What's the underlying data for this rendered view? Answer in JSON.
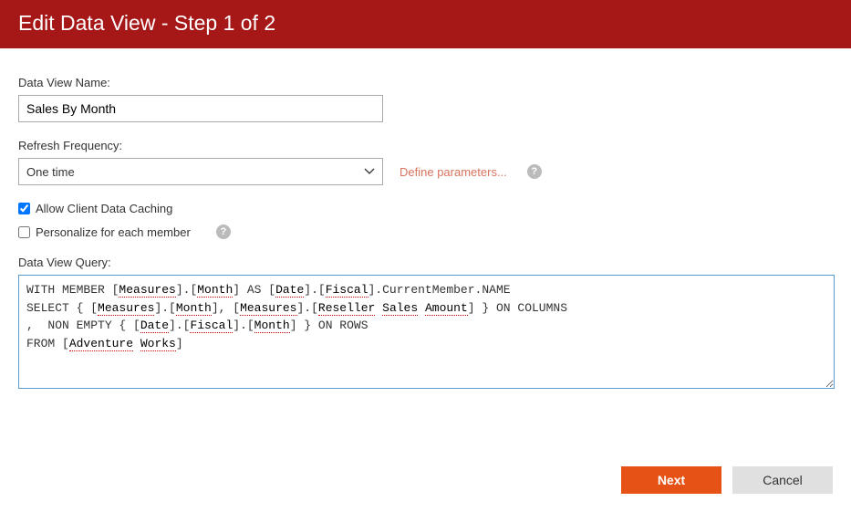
{
  "header": {
    "title": "Edit Data View - Step 1 of 2"
  },
  "fields": {
    "name_label": "Data View Name:",
    "name_value": "Sales By Month",
    "refresh_label": "Refresh Frequency:",
    "refresh_value": "One time",
    "define_params": "Define parameters...",
    "allow_cache": "Allow Client Data Caching",
    "allow_cache_checked": true,
    "personalize": "Personalize for each member",
    "personalize_checked": false,
    "query_label": "Data View Query:"
  },
  "query": {
    "line1a": "WITH MEMBER [",
    "line1b": "Measures",
    "line1c": "].[",
    "line1d": "Month",
    "line1e": "] AS [",
    "line1f": "Date",
    "line1g": "].[",
    "line1h": "Fiscal",
    "line1i": "].CurrentMember.NAME",
    "line2a": "SELECT { [",
    "line2b": "Measures",
    "line2c": "].[",
    "line2d": "Month",
    "line2e": "], [",
    "line2f": "Measures",
    "line2g": "].[",
    "line2h": "Reseller",
    "line2i": " ",
    "line2j": "Sales",
    "line2k": " ",
    "line2l": "Amount",
    "line2m": "] } ON COLUMNS",
    "line3a": ",  NON EMPTY { [",
    "line3b": "Date",
    "line3c": "].[",
    "line3d": "Fiscal",
    "line3e": "].[",
    "line3f": "Month",
    "line3g": "] } ON ROWS",
    "line4a": "FROM [",
    "line4b": "Adventure",
    "line4c": " ",
    "line4d": "Works",
    "line4e": "]"
  },
  "buttons": {
    "next": "Next",
    "cancel": "Cancel"
  },
  "icons": {
    "help": "?"
  }
}
